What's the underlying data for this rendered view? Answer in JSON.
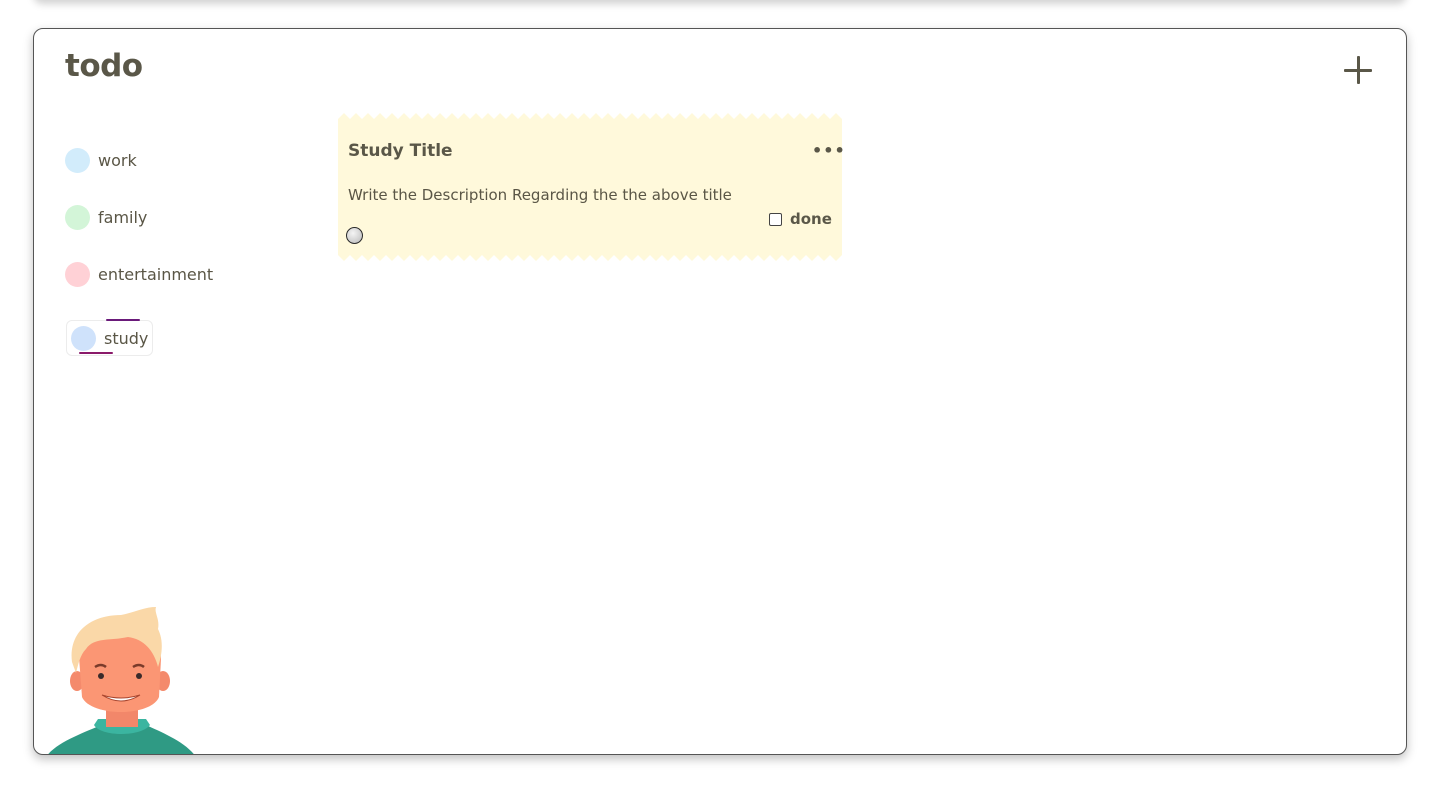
{
  "app": {
    "title": "todo",
    "add_button_icon": "plus-icon"
  },
  "categories": [
    {
      "label": "work",
      "color": "#d2ecfb"
    },
    {
      "label": "family",
      "color": "#d3f5d8"
    },
    {
      "label": "entertainment",
      "color": "#ffd1d6"
    },
    {
      "label": "study",
      "color": "#cfe2fb",
      "active": true
    }
  ],
  "note": {
    "title": "Study Title",
    "description": "Write the Description Regarding the the above title",
    "done_label": "done",
    "done_checked": false,
    "background": "#fff9db",
    "category_color": "#cfe2fb",
    "menu_icon": "more-horizontal-icon"
  },
  "avatar": {
    "icon": "user-avatar-illustration"
  }
}
